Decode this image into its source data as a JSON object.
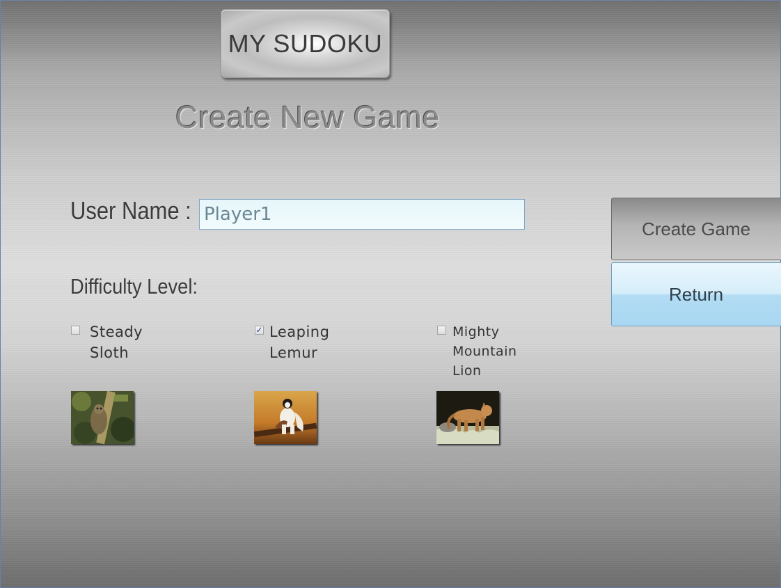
{
  "header": {
    "logo_label": "MY SUDOKU",
    "page_title": "Create New Game"
  },
  "form": {
    "username_label": "User Name :",
    "username_value": "Player1",
    "difficulty_label": "Difficulty Level:",
    "options": [
      {
        "label": "Steady\nSloth",
        "checked": false,
        "image": "sloth-image"
      },
      {
        "label": "Leaping\nLemur",
        "checked": true,
        "image": "lemur-image"
      },
      {
        "label": "Mighty\nMountain\nLion",
        "checked": false,
        "image": "mountain-lion-image"
      }
    ]
  },
  "actions": {
    "create_label": "Create Game",
    "return_label": "Return"
  },
  "colors": {
    "input_bg": "#e6f6fa",
    "return_button": "#b2dcf3",
    "check_mark": "#2a3a9a"
  }
}
